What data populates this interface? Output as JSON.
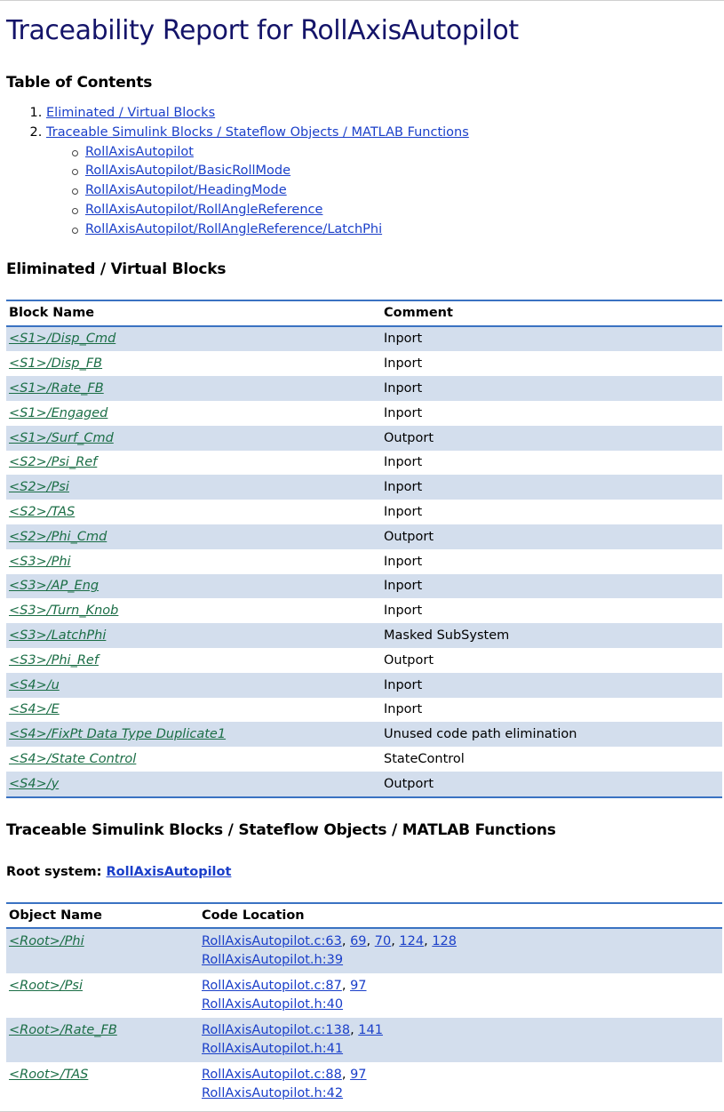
{
  "title": "Traceability Report for RollAxisAutopilot",
  "toc": {
    "heading": "Table of Contents",
    "items": [
      {
        "number": "1.",
        "label": "Eliminated / Virtual Blocks"
      },
      {
        "number": "2.",
        "label": "Traceable Simulink Blocks / Stateflow Objects / MATLAB Functions"
      }
    ],
    "subitems": [
      "RollAxisAutopilot",
      "RollAxisAutopilot/BasicRollMode",
      "RollAxisAutopilot/HeadingMode",
      "RollAxisAutopilot/RollAngleReference",
      "RollAxisAutopilot/RollAngleReference/LatchPhi"
    ]
  },
  "eliminated": {
    "heading": "Eliminated / Virtual Blocks",
    "columns": [
      "Block Name",
      "Comment"
    ],
    "rows": [
      {
        "name": "<S1>/Disp_Cmd",
        "comment": "Inport"
      },
      {
        "name": "<S1>/Disp_FB",
        "comment": "Inport"
      },
      {
        "name": "<S1>/Rate_FB",
        "comment": "Inport"
      },
      {
        "name": "<S1>/Engaged",
        "comment": "Inport"
      },
      {
        "name": "<S1>/Surf_Cmd",
        "comment": "Outport"
      },
      {
        "name": "<S2>/Psi_Ref",
        "comment": "Inport"
      },
      {
        "name": "<S2>/Psi",
        "comment": "Inport"
      },
      {
        "name": "<S2>/TAS",
        "comment": "Inport"
      },
      {
        "name": "<S2>/Phi_Cmd",
        "comment": "Outport"
      },
      {
        "name": "<S3>/Phi",
        "comment": "Inport"
      },
      {
        "name": "<S3>/AP_Eng",
        "comment": "Inport"
      },
      {
        "name": "<S3>/Turn_Knob",
        "comment": "Inport"
      },
      {
        "name": "<S3>/LatchPhi",
        "comment": "Masked SubSystem"
      },
      {
        "name": "<S3>/Phi_Ref",
        "comment": "Outport"
      },
      {
        "name": "<S4>/u",
        "comment": "Inport"
      },
      {
        "name": "<S4>/E",
        "comment": "Inport"
      },
      {
        "name": "<S4>/FixPt Data Type Duplicate1",
        "comment": "Unused code path elimination"
      },
      {
        "name": "<S4>/State Control",
        "comment": "StateControl"
      },
      {
        "name": "<S4>/y",
        "comment": "Outport"
      }
    ]
  },
  "traceable": {
    "heading": "Traceable Simulink Blocks / Stateflow Objects / MATLAB Functions",
    "root_label": "Root system: ",
    "root_link": "RollAxisAutopilot",
    "columns": [
      "Object Name",
      "Code Location"
    ],
    "rows": [
      {
        "name": "<Root>/Phi",
        "c_file": "RollAxisAutopilot.c:63",
        "c_lines": [
          "69",
          "70",
          "124",
          "128"
        ],
        "h_file": "RollAxisAutopilot.h:39"
      },
      {
        "name": "<Root>/Psi",
        "c_file": "RollAxisAutopilot.c:87",
        "c_lines": [
          "97"
        ],
        "h_file": "RollAxisAutopilot.h:40"
      },
      {
        "name": "<Root>/Rate_FB",
        "c_file": "RollAxisAutopilot.c:138",
        "c_lines": [
          "141"
        ],
        "h_file": "RollAxisAutopilot.h:41"
      },
      {
        "name": "<Root>/TAS",
        "c_file": "RollAxisAutopilot.c:88",
        "c_lines": [
          "97"
        ],
        "h_file": "RollAxisAutopilot.h:42"
      }
    ]
  },
  "colors": {
    "title": "#141469",
    "link_blue": "#1a3fc9",
    "link_green": "#1b6e46",
    "rule": "#3a72c2",
    "row_band": "#d3deed"
  }
}
